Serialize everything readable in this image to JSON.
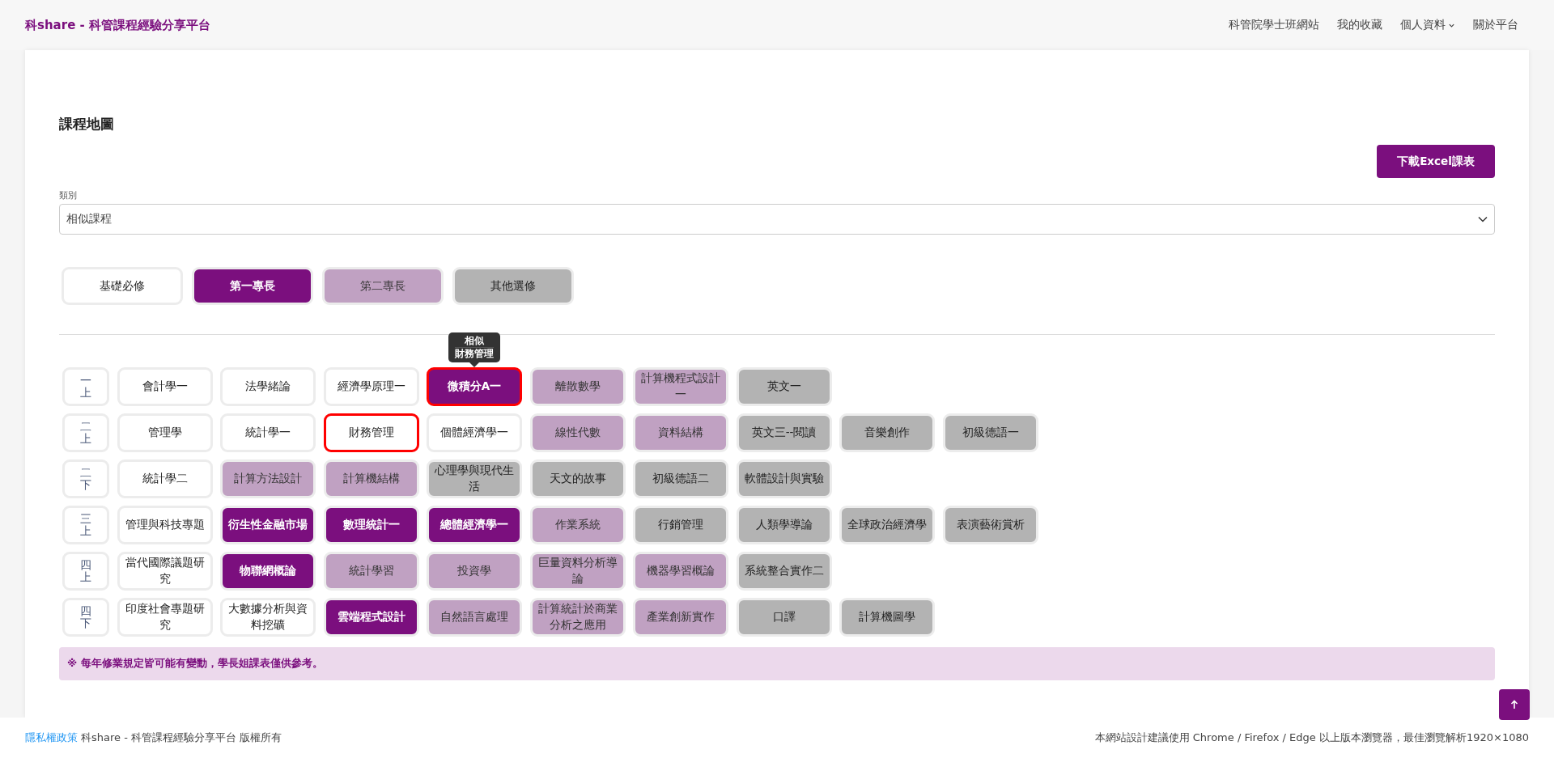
{
  "nav": {
    "brand": "科share - 科管課程經驗分享平台",
    "links": [
      {
        "label": "科管院學士班網站",
        "dropdown": false
      },
      {
        "label": "我的收藏",
        "dropdown": false
      },
      {
        "label": "個人資料",
        "dropdown": true
      },
      {
        "label": "關於平台",
        "dropdown": false
      }
    ]
  },
  "page": {
    "title": "課程地圖",
    "download_button": "下載Excel課表",
    "category": {
      "label": "類別",
      "value": "相似課程"
    }
  },
  "legend": [
    {
      "label": "基礎必修",
      "kind": "basic"
    },
    {
      "label": "第一專長",
      "kind": "first"
    },
    {
      "label": "第二專長",
      "kind": "second"
    },
    {
      "label": "其他選修",
      "kind": "other"
    }
  ],
  "rows": [
    {
      "semester": "一上",
      "courses": [
        {
          "name": "會計學一",
          "kind": "basic",
          "highlighted": false
        },
        {
          "name": "法學緒論",
          "kind": "basic",
          "highlighted": false
        },
        {
          "name": "經濟學原理一",
          "kind": "basic",
          "highlighted": false
        },
        {
          "name": "微積分A一",
          "kind": "first",
          "highlighted": true,
          "tooltip": {
            "title": "相似",
            "text": "財務管理"
          }
        },
        {
          "name": "離散數學",
          "kind": "second",
          "highlighted": false
        },
        {
          "name": "計算機程式設計一",
          "kind": "second",
          "highlighted": false
        },
        {
          "name": "英文一",
          "kind": "other",
          "highlighted": false
        }
      ]
    },
    {
      "semester": "二上",
      "courses": [
        {
          "name": "管理學",
          "kind": "basic",
          "highlighted": false
        },
        {
          "name": "統計學一",
          "kind": "basic",
          "highlighted": false
        },
        {
          "name": "財務管理",
          "kind": "basic",
          "highlighted": true
        },
        {
          "name": "個體經濟學一",
          "kind": "basic",
          "highlighted": false
        },
        {
          "name": "線性代數",
          "kind": "second",
          "highlighted": false
        },
        {
          "name": "資料結構",
          "kind": "second",
          "highlighted": false
        },
        {
          "name": "英文三--閱讀",
          "kind": "other",
          "highlighted": false
        },
        {
          "name": "音樂創作",
          "kind": "other",
          "highlighted": false
        },
        {
          "name": "初級德語一",
          "kind": "other",
          "highlighted": false
        }
      ]
    },
    {
      "semester": "二下",
      "courses": [
        {
          "name": "統計學二",
          "kind": "basic",
          "highlighted": false
        },
        {
          "name": "計算方法設計",
          "kind": "second",
          "highlighted": false
        },
        {
          "name": "計算機結構",
          "kind": "second",
          "highlighted": false
        },
        {
          "name": "心理學與現代生活",
          "kind": "other",
          "highlighted": false
        },
        {
          "name": "天文的故事",
          "kind": "other",
          "highlighted": false
        },
        {
          "name": "初級德語二",
          "kind": "other",
          "highlighted": false
        },
        {
          "name": "軟體設計與實驗",
          "kind": "other",
          "highlighted": false
        }
      ]
    },
    {
      "semester": "三上",
      "courses": [
        {
          "name": "管理與科技專題",
          "kind": "basic",
          "highlighted": false
        },
        {
          "name": "衍生性金融市場",
          "kind": "first",
          "highlighted": false
        },
        {
          "name": "數理統計一",
          "kind": "first",
          "highlighted": false
        },
        {
          "name": "總體經濟學一",
          "kind": "first",
          "highlighted": false
        },
        {
          "name": "作業系統",
          "kind": "second",
          "highlighted": false
        },
        {
          "name": "行銷管理",
          "kind": "other",
          "highlighted": false
        },
        {
          "name": "人類學導論",
          "kind": "other",
          "highlighted": false
        },
        {
          "name": "全球政治經濟學",
          "kind": "other",
          "highlighted": false
        },
        {
          "name": "表演藝術賞析",
          "kind": "other",
          "highlighted": false
        }
      ]
    },
    {
      "semester": "四上",
      "courses": [
        {
          "name": "當代國際議題研究",
          "kind": "basic",
          "highlighted": false
        },
        {
          "name": "物聯網概論",
          "kind": "first",
          "highlighted": false
        },
        {
          "name": "統計學習",
          "kind": "second",
          "highlighted": false
        },
        {
          "name": "投資學",
          "kind": "second",
          "highlighted": false
        },
        {
          "name": "巨量資料分析導論",
          "kind": "second",
          "highlighted": false
        },
        {
          "name": "機器學習概論",
          "kind": "second",
          "highlighted": false
        },
        {
          "name": "系統整合實作二",
          "kind": "other",
          "highlighted": false
        }
      ]
    },
    {
      "semester": "四下",
      "courses": [
        {
          "name": "印度社會專題研究",
          "kind": "basic",
          "highlighted": false
        },
        {
          "name": "大數據分析與資料挖礦",
          "kind": "basic",
          "highlighted": false
        },
        {
          "name": "雲端程式設計",
          "kind": "first",
          "highlighted": false
        },
        {
          "name": "自然語言處理",
          "kind": "second",
          "highlighted": false
        },
        {
          "name": "計算統計於商業分析之應用",
          "kind": "second",
          "highlighted": false
        },
        {
          "name": "產業創新實作",
          "kind": "second",
          "highlighted": false
        },
        {
          "name": "口譯",
          "kind": "other",
          "highlighted": false
        },
        {
          "name": "計算機圖學",
          "kind": "other",
          "highlighted": false
        }
      ]
    }
  ],
  "note": "※ 每年修業規定皆可能有變動，學長姐課表僅供參考。",
  "footer": {
    "privacy_link": "隱私權政策",
    "copyright": "科share - 科管課程經驗分享平台 版權所有",
    "browser_note": "本網站設計建議使用 Chrome / Firefox / Edge 以上版本瀏覽器，最佳瀏覽解析1920×1080"
  }
}
